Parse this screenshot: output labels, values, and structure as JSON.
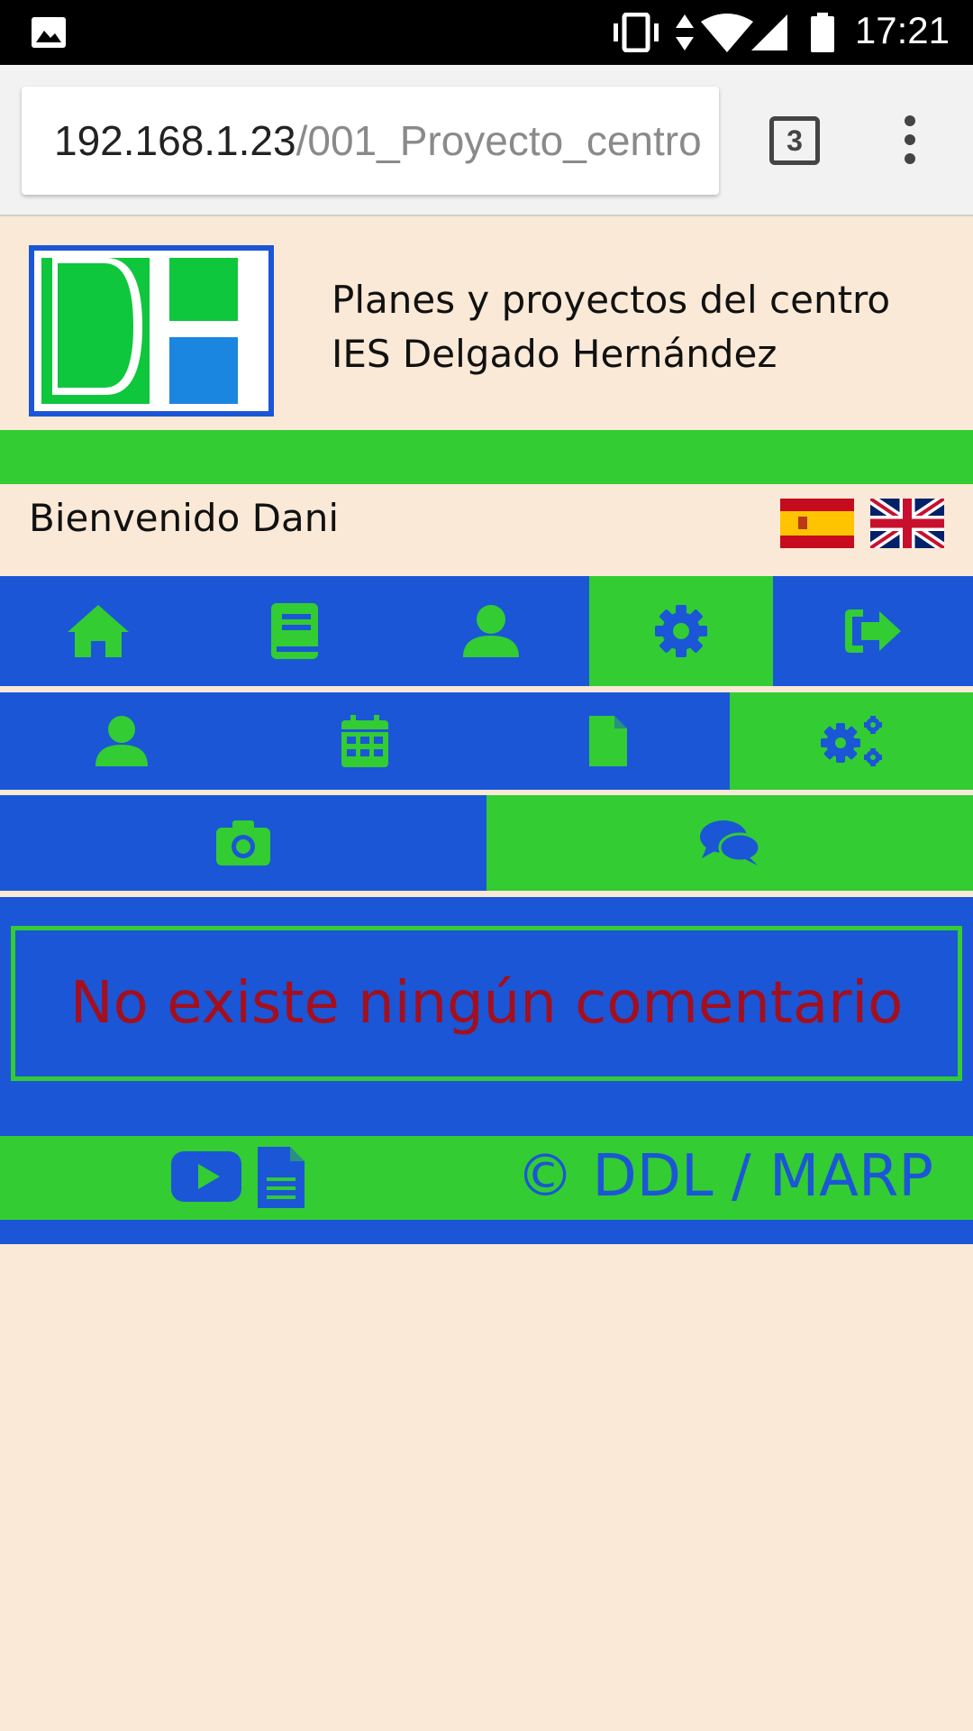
{
  "status_bar": {
    "time": "17:21",
    "icons": [
      "image-icon",
      "vibrate-icon",
      "data-arrows-icon",
      "wifi-icon",
      "signal-icon",
      "battery-icon"
    ]
  },
  "browser": {
    "url_host": "192.168.1.23",
    "url_path": "/001_Proyecto_centro",
    "tab_count": "3",
    "menu_icon": "more-vert-icon"
  },
  "header": {
    "logo_text": "DH",
    "title_line1": "Planes y proyectos del centro",
    "title_line2": "IES Delgado Hernández"
  },
  "welcome": "Bienvenido Dani",
  "languages": [
    "es-flag-icon",
    "uk-flag-icon"
  ],
  "nav": {
    "row1": [
      {
        "icon": "home-icon",
        "active": false
      },
      {
        "icon": "book-icon",
        "active": false
      },
      {
        "icon": "user-icon",
        "active": false
      },
      {
        "icon": "gear-icon",
        "active": true
      },
      {
        "icon": "sign-out-icon",
        "active": false
      }
    ],
    "row2": [
      {
        "icon": "user-icon",
        "active": false
      },
      {
        "icon": "calendar-icon",
        "active": false
      },
      {
        "icon": "file-icon",
        "active": false
      },
      {
        "icon": "gears-icon",
        "active": true
      }
    ],
    "row3": [
      {
        "icon": "camera-icon",
        "active": false
      },
      {
        "icon": "comments-icon",
        "active": true
      }
    ]
  },
  "content": {
    "message": "No existe ningún comentario"
  },
  "footer": {
    "icons": [
      "youtube-icon",
      "document-icon"
    ],
    "copyright": "© DDL / MARP"
  },
  "colors": {
    "blue": "#1b56d6",
    "green": "#33cc33",
    "background": "#f9e9d6",
    "message": "#a30f1e"
  }
}
